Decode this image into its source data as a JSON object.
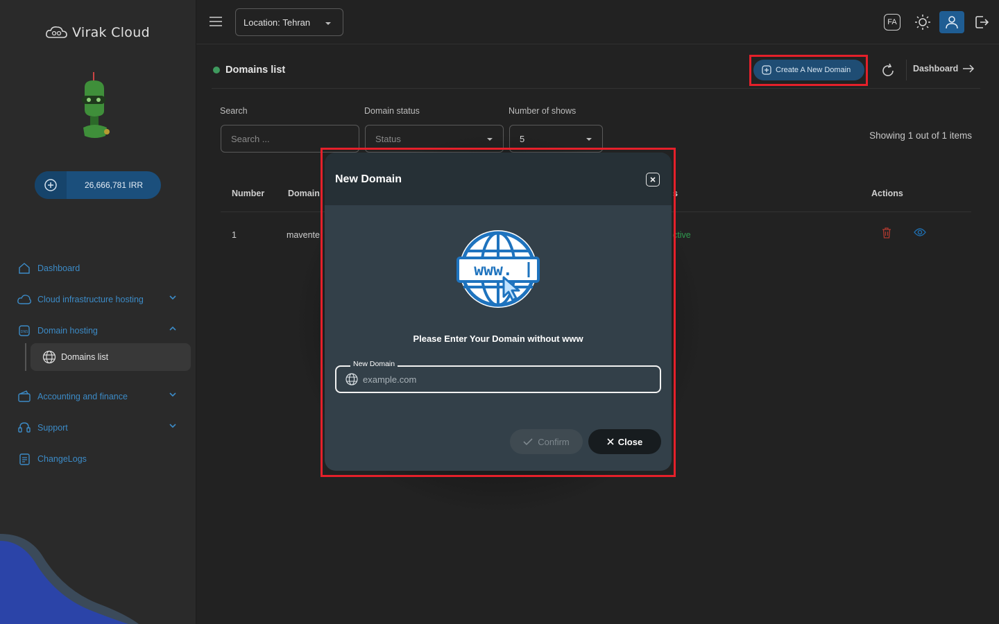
{
  "brand": {
    "name": "Virak Cloud"
  },
  "wallet": {
    "balance": "26,666,781",
    "currency": "IRR"
  },
  "sidebar": {
    "items": [
      {
        "label": "Dashboard",
        "icon": "home-icon"
      },
      {
        "label": "Cloud infrastructure hosting",
        "icon": "cloud-icon",
        "expandable": true
      },
      {
        "label": "Domain hosting",
        "icon": "dns-icon",
        "expandable": true,
        "expanded": true
      },
      {
        "label": "Accounting and finance",
        "icon": "wallet-icon",
        "expandable": true
      },
      {
        "label": "Support",
        "icon": "support-icon",
        "expandable": true
      },
      {
        "label": "ChangeLogs",
        "icon": "changelog-icon"
      }
    ],
    "subitem": {
      "label": "Domains list",
      "icon": "globe-icon"
    }
  },
  "topbar": {
    "location_label": "Location:",
    "location_value": "Tehran",
    "language": "FA"
  },
  "page": {
    "title": "Domains list",
    "create_button": "Create A New Domain",
    "dashboard_link": "Dashboard"
  },
  "filters": {
    "search_label": "Search",
    "search_placeholder": "Search ...",
    "status_label": "Domain status",
    "status_value": "Status",
    "count_label": "Number of shows",
    "count_value": "5",
    "showing": "Showing 1 out of 1 items"
  },
  "table": {
    "headers": [
      "Number",
      "Domain",
      "s",
      "Actions"
    ],
    "rows": [
      {
        "number": "1",
        "domain": "mavente",
        "status": "ctive"
      }
    ]
  },
  "modal": {
    "title": "New Domain",
    "message": "Please Enter Your Domain without www",
    "field_label": "New Domain",
    "field_placeholder": "example.com",
    "field_value": "",
    "confirm": "Confirm",
    "close": "Close"
  },
  "colors": {
    "accent": "#1f4d74",
    "highlight": "#e5202a",
    "nav_text": "#3c8bc7",
    "status_active": "#2f9a4f",
    "delete": "#c0392b"
  }
}
